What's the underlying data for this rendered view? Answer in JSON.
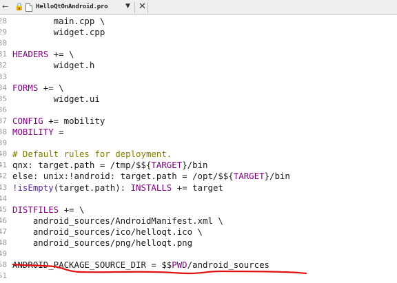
{
  "tab": {
    "file_name": "HelloQtOnAndroid.pro",
    "dropdown_icon": "dropdown-arrow-icon",
    "close_icon": "close-icon"
  },
  "editor": {
    "lines": [
      {
        "num": "28",
        "segments": [
          {
            "t": "        main.cpp \\",
            "c": "plain"
          }
        ]
      },
      {
        "num": "29",
        "segments": [
          {
            "t": "        widget.cpp",
            "c": "plain"
          }
        ]
      },
      {
        "num": "30",
        "segments": [
          {
            "t": "",
            "c": "plain"
          }
        ]
      },
      {
        "num": "31",
        "segments": [
          {
            "t": "HEADERS",
            "c": "var"
          },
          {
            "t": " += \\",
            "c": "plain"
          }
        ]
      },
      {
        "num": "32",
        "segments": [
          {
            "t": "        widget.h",
            "c": "plain"
          }
        ]
      },
      {
        "num": "33",
        "segments": [
          {
            "t": "",
            "c": "plain"
          }
        ]
      },
      {
        "num": "34",
        "segments": [
          {
            "t": "FORMS",
            "c": "var"
          },
          {
            "t": " += \\",
            "c": "plain"
          }
        ]
      },
      {
        "num": "35",
        "segments": [
          {
            "t": "        widget.ui",
            "c": "plain"
          }
        ]
      },
      {
        "num": "36",
        "segments": [
          {
            "t": "",
            "c": "plain"
          }
        ]
      },
      {
        "num": "37",
        "segments": [
          {
            "t": "CONFIG",
            "c": "var"
          },
          {
            "t": " += mobility",
            "c": "plain"
          }
        ]
      },
      {
        "num": "38",
        "segments": [
          {
            "t": "MOBILITY",
            "c": "var"
          },
          {
            "t": " =",
            "c": "plain"
          }
        ]
      },
      {
        "num": "39",
        "segments": [
          {
            "t": "",
            "c": "plain"
          }
        ]
      },
      {
        "num": "40",
        "segments": [
          {
            "t": "# Default rules for deployment.",
            "c": "cmt"
          }
        ]
      },
      {
        "num": "41",
        "segments": [
          {
            "t": "qnx: target.path = /tmp/$${",
            "c": "plain"
          },
          {
            "t": "TARGET",
            "c": "var"
          },
          {
            "t": "}/bin",
            "c": "plain"
          }
        ]
      },
      {
        "num": "42",
        "segments": [
          {
            "t": "else: unix:!android: target.path = /opt/$${",
            "c": "plain"
          },
          {
            "t": "TARGET",
            "c": "var"
          },
          {
            "t": "}/bin",
            "c": "plain"
          }
        ]
      },
      {
        "num": "43",
        "segments": [
          {
            "t": "!isEmpty",
            "c": "fn"
          },
          {
            "t": "(target.path): ",
            "c": "plain"
          },
          {
            "t": "INSTALLS",
            "c": "var"
          },
          {
            "t": " += target",
            "c": "plain"
          }
        ]
      },
      {
        "num": "44",
        "segments": [
          {
            "t": "",
            "c": "plain"
          }
        ]
      },
      {
        "num": "45",
        "segments": [
          {
            "t": "DISTFILES",
            "c": "var"
          },
          {
            "t": " += \\",
            "c": "plain"
          }
        ]
      },
      {
        "num": "46",
        "segments": [
          {
            "t": "    android_sources/AndroidManifest.xml \\",
            "c": "plain"
          }
        ]
      },
      {
        "num": "47",
        "segments": [
          {
            "t": "    android_sources/ico/helloqt.ico \\",
            "c": "plain"
          }
        ]
      },
      {
        "num": "48",
        "segments": [
          {
            "t": "    android_sources/png/helloqt.png",
            "c": "plain"
          }
        ]
      },
      {
        "num": "49",
        "segments": [
          {
            "t": "",
            "c": "plain"
          }
        ]
      },
      {
        "num": "58",
        "segments": [
          {
            "t": "ANDROID_PACKAGE_SOURCE_DIR = $$",
            "c": "plain"
          },
          {
            "t": "PWD",
            "c": "var"
          },
          {
            "t": "/android_sources",
            "c": "plain"
          }
        ]
      },
      {
        "num": "51",
        "segments": [
          {
            "t": "",
            "c": "plain"
          }
        ]
      }
    ],
    "colors": {
      "plain": "#1a1a1a",
      "var": "#800080",
      "cmt": "#808000",
      "fn": "#5a2a9a",
      "line_number": "#9a9a9a",
      "annotation": "#e01010"
    }
  }
}
